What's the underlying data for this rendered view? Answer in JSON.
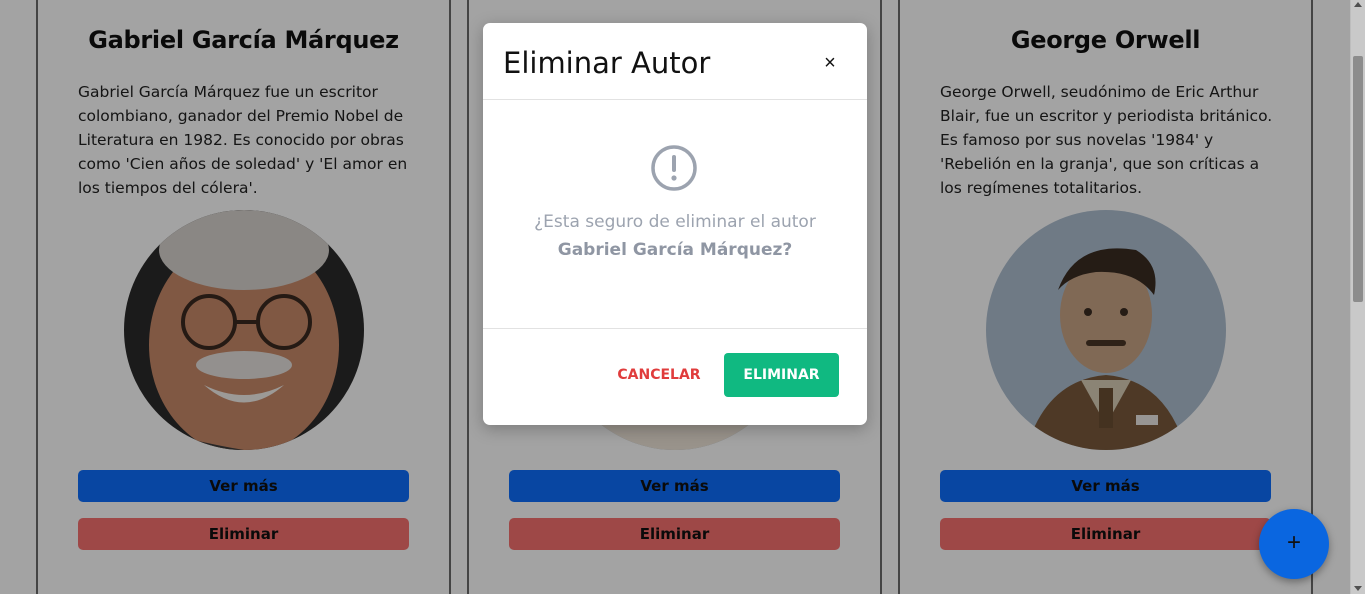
{
  "cards": [
    {
      "title": "Gabriel García Márquez",
      "description": "Gabriel García Márquez fue un escritor colombiano, ganador del Premio Nobel de Literatura en 1982. Es conocido por obras como 'Cien años de soledad' y 'El amor en los tiempos del cólera'.",
      "more_label": "Ver más",
      "delete_label": "Eliminar"
    },
    {
      "title": "",
      "description": "",
      "more_label": "Ver más",
      "delete_label": "Eliminar"
    },
    {
      "title": "George Orwell",
      "description": "George Orwell, seudónimo de Eric Arthur Blair, fue un escritor y periodista británico. Es famoso por sus novelas '1984' y 'Rebelión en la granja', que son críticas a los regímenes totalitarios.",
      "more_label": "Ver más",
      "delete_label": "Eliminar"
    }
  ],
  "fab": {
    "label": "+"
  },
  "modal": {
    "title": "Eliminar Autor",
    "close_label": "×",
    "message": "¿Esta seguro de eliminar el autor",
    "author_name": "Gabriel García Márquez?",
    "cancel_label": "CANCELAR",
    "confirm_label": "ELIMINAR"
  },
  "colors": {
    "primary": "#0d6efd",
    "danger": "#f8716f",
    "success": "#10b981",
    "cancel_text": "#e03c3c",
    "fab": "#0a66e0"
  },
  "icons": {
    "warning": "exclamation-circle-icon",
    "close": "close-icon",
    "add": "plus-icon"
  }
}
